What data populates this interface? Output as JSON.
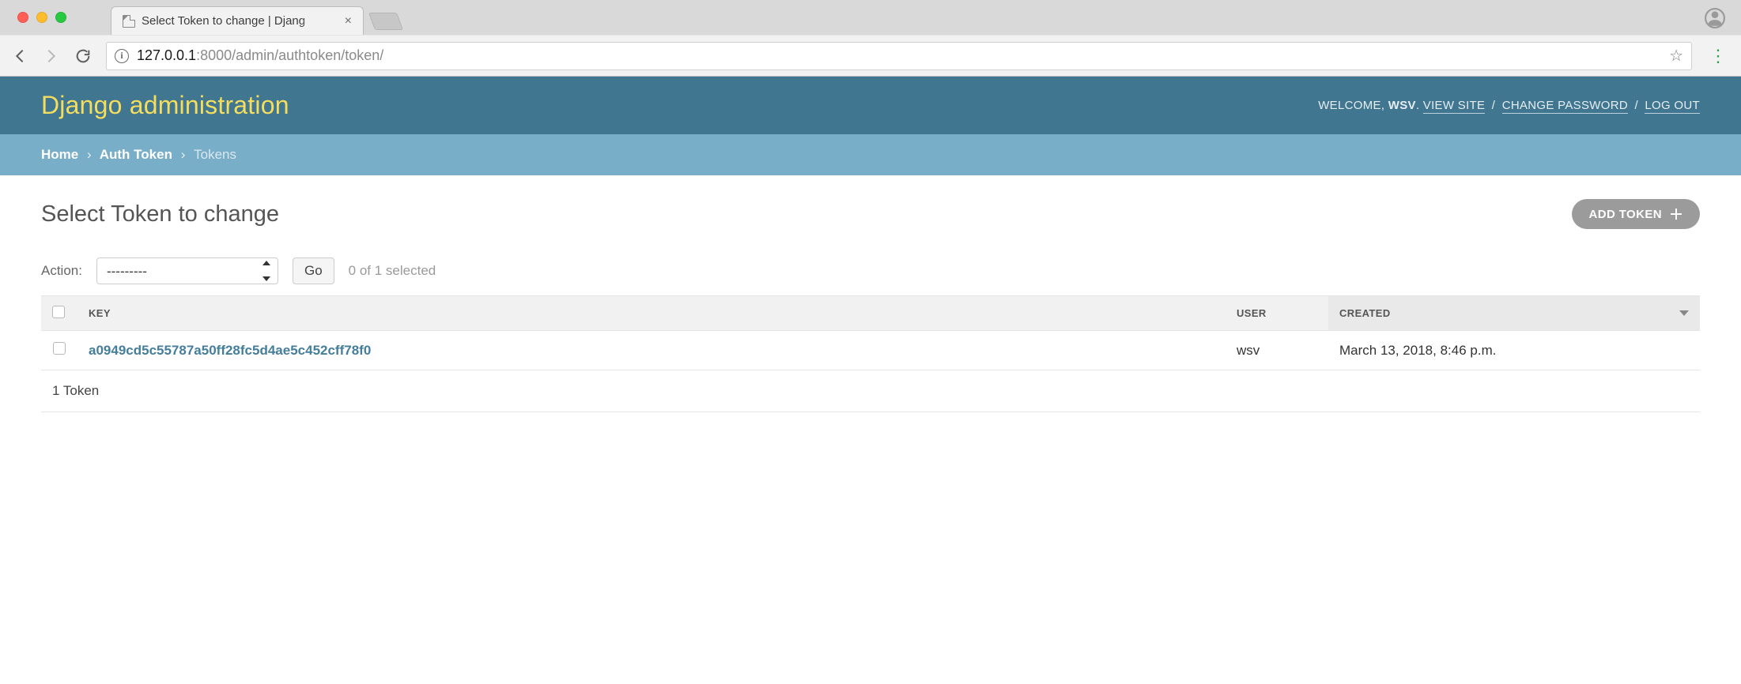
{
  "browser": {
    "tab_title": "Select Token to change | Djang",
    "url_host": "127.0.0.1",
    "url_path": ":8000/admin/authtoken/token/"
  },
  "header": {
    "site_title": "Django administration",
    "welcome": "WELCOME,",
    "username": "WSV",
    "view_site": "VIEW SITE",
    "change_password": "CHANGE PASSWORD",
    "log_out": "LOG OUT"
  },
  "breadcrumbs": {
    "home": "Home",
    "app": "Auth Token",
    "model": "Tokens"
  },
  "page": {
    "title": "Select Token to change",
    "add_button": "ADD TOKEN"
  },
  "actions": {
    "label": "Action:",
    "placeholder": "---------",
    "go": "Go",
    "selection_count": "0 of 1 selected"
  },
  "table": {
    "headers": {
      "key": "KEY",
      "user": "USER",
      "created": "CREATED"
    },
    "rows": [
      {
        "key": "a0949cd5c55787a50ff28fc5d4ae5c452cff78f0",
        "user": "wsv",
        "created": "March 13, 2018, 8:46 p.m."
      }
    ],
    "paginator": "1 Token"
  }
}
